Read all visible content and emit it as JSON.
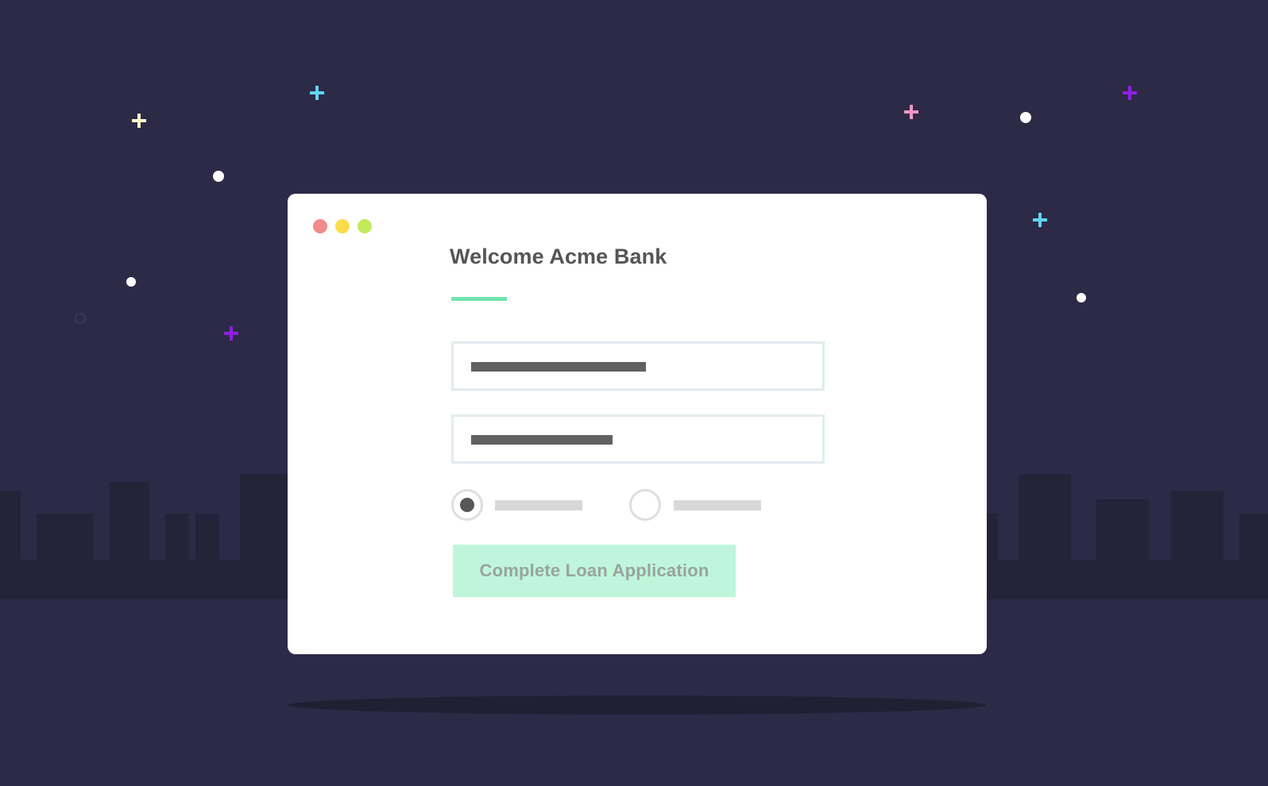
{
  "window": {
    "title": "Welcome Acme Bank",
    "controls": [
      {
        "name": "close",
        "color": "#f28b8b"
      },
      {
        "name": "minimize",
        "color": "#fcdc4c"
      },
      {
        "name": "maximize",
        "color": "#c2eb5c"
      }
    ]
  },
  "form": {
    "fields": [
      {
        "name": "first-input",
        "value_redacted": true
      },
      {
        "name": "second-input",
        "value_redacted": true
      }
    ],
    "radios": [
      {
        "name": "option-1",
        "selected": true
      },
      {
        "name": "option-2",
        "selected": false
      }
    ],
    "submit_label": "Complete Loan Application"
  },
  "colors": {
    "background": "#2c2a47",
    "skyline": "#24233a",
    "accent_green": "#75e3ae",
    "button_bg": "#bff6db",
    "button_text": "#9aa3a0",
    "title_text": "#555555",
    "star_cyan": "#5fd4f0",
    "star_purple": "#8f1fe0",
    "star_pink": "#f295c0",
    "star_cream": "#fff6cc",
    "star_white": "#ffffff"
  },
  "decorations": [
    {
      "shape": "plus",
      "color": "#fff6cc"
    },
    {
      "shape": "plus",
      "color": "#5fd4f0"
    },
    {
      "shape": "plus",
      "color": "#8f1fe0"
    },
    {
      "shape": "plus",
      "color": "#f295c0"
    },
    {
      "shape": "plus",
      "color": "#8f1fe0"
    },
    {
      "shape": "plus",
      "color": "#5fd4f0"
    },
    {
      "shape": "dot",
      "color": "#ffffff"
    }
  ]
}
